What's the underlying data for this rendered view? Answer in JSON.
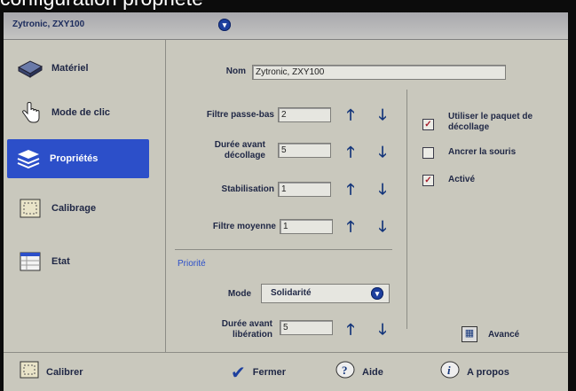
{
  "caption": "configuration propriété",
  "window": {
    "title": "Zytronic, ZXY100"
  },
  "sidebar": {
    "items": [
      {
        "label": "Matériel",
        "icon": "hardware-icon"
      },
      {
        "label": "Mode de clic",
        "icon": "hand-pointer-icon"
      },
      {
        "label": "Propriétés",
        "icon": "layers-icon"
      },
      {
        "label": "Calibrage",
        "icon": "calibration-icon"
      },
      {
        "label": "Etat",
        "icon": "status-table-icon"
      }
    ]
  },
  "name": {
    "label": "Nom",
    "value": "Zytronic, ZXY100"
  },
  "settings": {
    "lowpass": {
      "label": "Filtre passe-bas",
      "value": "2"
    },
    "liftoff_delay": {
      "label": "Durée avant décollage",
      "value": "5"
    },
    "stabilization": {
      "label": "Stabilisation",
      "value": "1"
    },
    "average_filter": {
      "label": "Filtre moyenne",
      "value": "1"
    }
  },
  "priority": {
    "section_title": "Priorité",
    "mode_label": "Mode",
    "mode_value": "Solidarité",
    "release_label": "Durée avant libération",
    "release_value": "5"
  },
  "options": {
    "use_liftoff_packet": {
      "label": "Utiliser le paquet de décollage",
      "checked": true
    },
    "anchor_mouse": {
      "label": "Ancrer la souris",
      "checked": false
    },
    "enabled": {
      "label": "Activé",
      "checked": true
    }
  },
  "advanced": {
    "label": "Avancé"
  },
  "footer": {
    "calibrate": "Calibrer",
    "close": "Fermer",
    "help": "Aide",
    "about": "A propos"
  },
  "colors": {
    "accent": "#2c4fc9",
    "panel": "#c9c8bd",
    "arrow": "#12347a"
  }
}
